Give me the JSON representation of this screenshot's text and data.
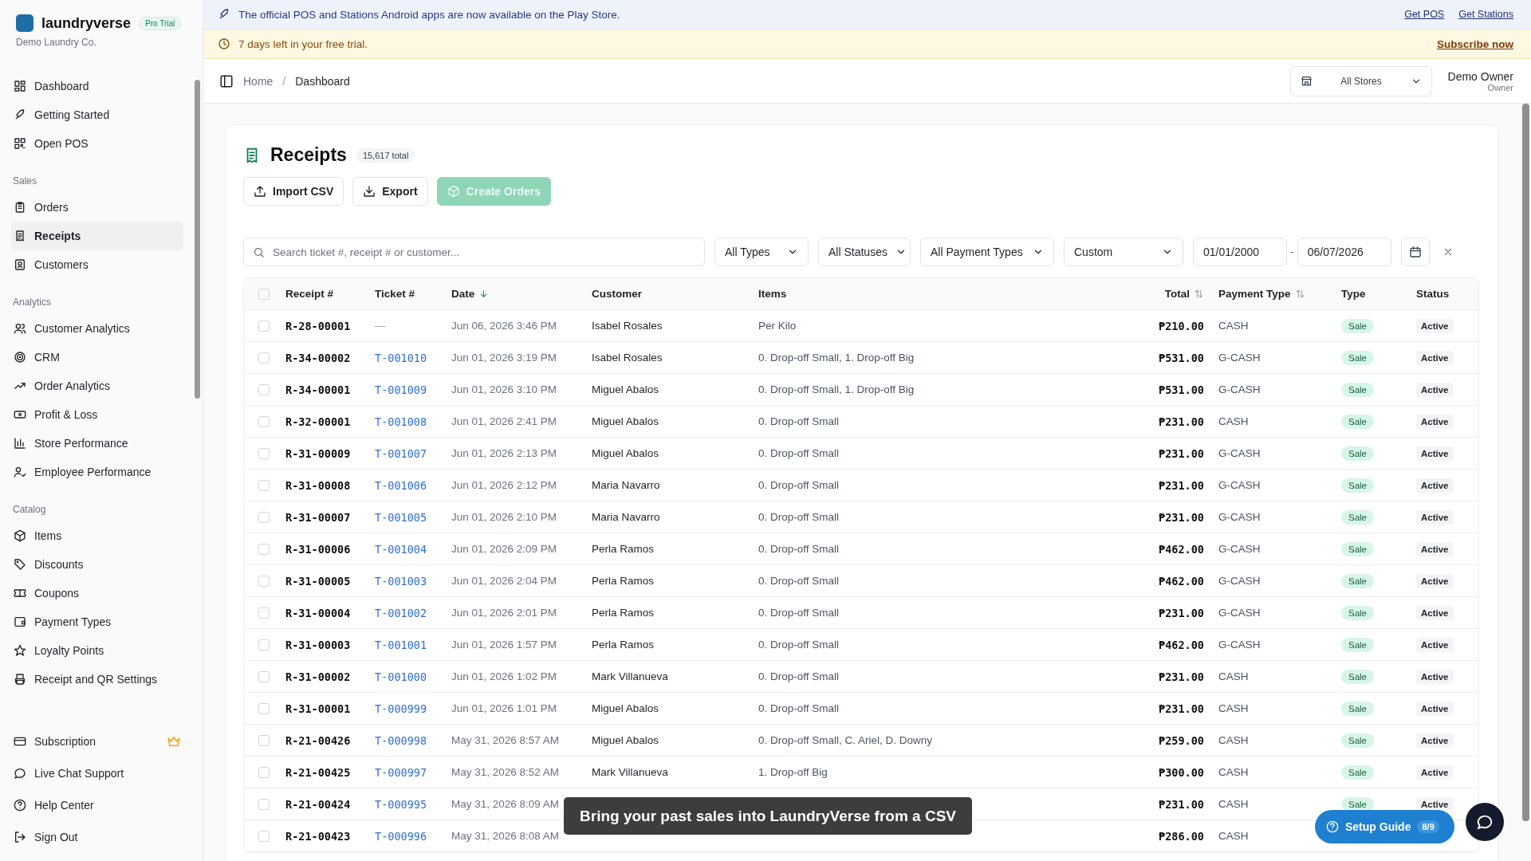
{
  "sidebar": {
    "brand": "laundryverse",
    "plan_badge": "Pro Trial",
    "company": "Demo Laundry Co.",
    "sections": [
      {
        "items": [
          {
            "label": "Dashboard",
            "selected": false
          },
          {
            "label": "Getting Started",
            "selected": false
          },
          {
            "label": "Open POS",
            "selected": false
          }
        ]
      },
      {
        "title": "Sales",
        "items": [
          {
            "label": "Orders",
            "selected": false
          },
          {
            "label": "Receipts",
            "selected": true
          },
          {
            "label": "Customers",
            "selected": false
          }
        ]
      },
      {
        "title": "Analytics",
        "items": [
          {
            "label": "Customer Analytics",
            "selected": false
          },
          {
            "label": "CRM",
            "selected": false
          },
          {
            "label": "Order Analytics",
            "selected": false
          },
          {
            "label": "Profit & Loss",
            "selected": false
          },
          {
            "label": "Store Performance",
            "selected": false
          },
          {
            "label": "Employee Performance",
            "selected": false
          }
        ]
      },
      {
        "title": "Catalog",
        "items": [
          {
            "label": "Items",
            "selected": false
          },
          {
            "label": "Discounts",
            "selected": false
          },
          {
            "label": "Coupons",
            "selected": false
          },
          {
            "label": "Payment Types",
            "selected": false
          },
          {
            "label": "Loyalty Points",
            "selected": false
          },
          {
            "label": "Receipt and QR Settings",
            "selected": false
          }
        ]
      }
    ],
    "bottom_items": [
      {
        "label": "Subscription",
        "premium": true
      },
      {
        "label": "Live Chat Support",
        "premium": false
      },
      {
        "label": "Help Center",
        "premium": false
      },
      {
        "label": "Sign Out",
        "premium": false
      }
    ]
  },
  "announcement": {
    "text": "The official POS and Stations Android apps are now available on the Play Store.",
    "links": [
      "Get POS",
      "Get Stations"
    ]
  },
  "trial_banner": {
    "text": "7 days left in your free trial.",
    "link": "Subscribe now"
  },
  "breadcrumb": [
    "Home",
    "Dashboard"
  ],
  "breadcrumb_separator": "/",
  "store_select": {
    "value": "All Stores"
  },
  "user": {
    "name": "Demo Owner",
    "role": "Owner"
  },
  "page": {
    "title": "Receipts",
    "count": "15,617 total",
    "actions": [
      {
        "label": "Import CSV",
        "kind": "upload",
        "disabled": false
      },
      {
        "label": "Export",
        "kind": "download",
        "disabled": false
      },
      {
        "label": "Create Orders",
        "kind": "create",
        "disabled": true
      }
    ]
  },
  "filters": {
    "search": {
      "placeholder": "Search ticket #, receipt # or customer..."
    },
    "selects": [
      "All Types",
      "All Statuses",
      "All Payment Types",
      "Custom"
    ],
    "date_from": "01/01/2000",
    "date_separator": "-",
    "date_to": "06/07/2026"
  },
  "table": {
    "all_checked": false,
    "columns": [
      {
        "label": "Receipt #",
        "sortable": false,
        "sorted": false
      },
      {
        "label": "Ticket #",
        "sortable": false,
        "sorted": false
      },
      {
        "label": "Date",
        "sortable": true,
        "sorted": true
      },
      {
        "label": "Customer",
        "sortable": false,
        "sorted": false
      },
      {
        "label": "Items",
        "sortable": false,
        "sorted": false
      },
      {
        "label": "Total",
        "sortable": true,
        "sorted": false
      },
      {
        "label": "Payment Type",
        "sortable": true,
        "sorted": false
      },
      {
        "label": "Type",
        "sortable": false,
        "sorted": false
      },
      {
        "label": "Status",
        "sortable": false,
        "sorted": false
      }
    ],
    "rows": [
      {
        "checked": false,
        "receipt": "R-28-00001",
        "ticket": "—",
        "linked": false,
        "date": "Jun 06, 2026 3:46 PM",
        "customer": "Isabel Rosales",
        "items": "Per Kilo",
        "total": "₱210.00",
        "payment": "CASH",
        "type": "Sale",
        "status": "Active"
      },
      {
        "checked": false,
        "receipt": "R-34-00002",
        "ticket": "T-001010",
        "linked": true,
        "date": "Jun 01, 2026 3:19 PM",
        "customer": "Isabel Rosales",
        "items": "0. Drop-off Small, 1. Drop-off Big",
        "total": "₱531.00",
        "payment": "G-CASH",
        "type": "Sale",
        "status": "Active"
      },
      {
        "checked": false,
        "receipt": "R-34-00001",
        "ticket": "T-001009",
        "linked": true,
        "date": "Jun 01, 2026 3:10 PM",
        "customer": "Miguel Abalos",
        "items": "0. Drop-off Small, 1. Drop-off Big",
        "total": "₱531.00",
        "payment": "G-CASH",
        "type": "Sale",
        "status": "Active"
      },
      {
        "checked": false,
        "receipt": "R-32-00001",
        "ticket": "T-001008",
        "linked": true,
        "date": "Jun 01, 2026 2:41 PM",
        "customer": "Miguel Abalos",
        "items": "0. Drop-off Small",
        "total": "₱231.00",
        "payment": "CASH",
        "type": "Sale",
        "status": "Active"
      },
      {
        "checked": false,
        "receipt": "R-31-00009",
        "ticket": "T-001007",
        "linked": true,
        "date": "Jun 01, 2026 2:13 PM",
        "customer": "Miguel Abalos",
        "items": "0. Drop-off Small",
        "total": "₱231.00",
        "payment": "G-CASH",
        "type": "Sale",
        "status": "Active"
      },
      {
        "checked": false,
        "receipt": "R-31-00008",
        "ticket": "T-001006",
        "linked": true,
        "date": "Jun 01, 2026 2:12 PM",
        "customer": "Maria Navarro",
        "items": "0. Drop-off Small",
        "total": "₱231.00",
        "payment": "G-CASH",
        "type": "Sale",
        "status": "Active"
      },
      {
        "checked": false,
        "receipt": "R-31-00007",
        "ticket": "T-001005",
        "linked": true,
        "date": "Jun 01, 2026 2:10 PM",
        "customer": "Maria Navarro",
        "items": "0. Drop-off Small",
        "total": "₱231.00",
        "payment": "G-CASH",
        "type": "Sale",
        "status": "Active"
      },
      {
        "checked": false,
        "receipt": "R-31-00006",
        "ticket": "T-001004",
        "linked": true,
        "date": "Jun 01, 2026 2:09 PM",
        "customer": "Perla Ramos",
        "items": "0. Drop-off Small",
        "total": "₱462.00",
        "payment": "G-CASH",
        "type": "Sale",
        "status": "Active"
      },
      {
        "checked": false,
        "receipt": "R-31-00005",
        "ticket": "T-001003",
        "linked": true,
        "date": "Jun 01, 2026 2:04 PM",
        "customer": "Perla Ramos",
        "items": "0. Drop-off Small",
        "total": "₱462.00",
        "payment": "G-CASH",
        "type": "Sale",
        "status": "Active"
      },
      {
        "checked": false,
        "receipt": "R-31-00004",
        "ticket": "T-001002",
        "linked": true,
        "date": "Jun 01, 2026 2:01 PM",
        "customer": "Perla Ramos",
        "items": "0. Drop-off Small",
        "total": "₱231.00",
        "payment": "G-CASH",
        "type": "Sale",
        "status": "Active"
      },
      {
        "checked": false,
        "receipt": "R-31-00003",
        "ticket": "T-001001",
        "linked": true,
        "date": "Jun 01, 2026 1:57 PM",
        "customer": "Perla Ramos",
        "items": "0. Drop-off Small",
        "total": "₱462.00",
        "payment": "G-CASH",
        "type": "Sale",
        "status": "Active"
      },
      {
        "checked": false,
        "receipt": "R-31-00002",
        "ticket": "T-001000",
        "linked": true,
        "date": "Jun 01, 2026 1:02 PM",
        "customer": "Mark Villanueva",
        "items": "0. Drop-off Small",
        "total": "₱231.00",
        "payment": "CASH",
        "type": "Sale",
        "status": "Active"
      },
      {
        "checked": false,
        "receipt": "R-31-00001",
        "ticket": "T-000999",
        "linked": true,
        "date": "Jun 01, 2026 1:01 PM",
        "customer": "Miguel Abalos",
        "items": "0. Drop-off Small",
        "total": "₱231.00",
        "payment": "CASH",
        "type": "Sale",
        "status": "Active"
      },
      {
        "checked": false,
        "receipt": "R-21-00426",
        "ticket": "T-000998",
        "linked": true,
        "date": "May 31, 2026 8:57 AM",
        "customer": "Miguel Abalos",
        "items": "0. Drop-off Small, C. Ariel, D. Downy",
        "total": "₱259.00",
        "payment": "CASH",
        "type": "Sale",
        "status": "Active"
      },
      {
        "checked": false,
        "receipt": "R-21-00425",
        "ticket": "T-000997",
        "linked": true,
        "date": "May 31, 2026 8:52 AM",
        "customer": "Mark Villanueva",
        "items": "1. Drop-off Big",
        "total": "₱300.00",
        "payment": "CASH",
        "type": "Sale",
        "status": "Active"
      },
      {
        "checked": false,
        "receipt": "R-21-00424",
        "ticket": "T-000995",
        "linked": true,
        "date": "May 31, 2026 8:09 AM",
        "total": "₱231.00",
        "payment": "CASH",
        "type": "Sale",
        "status": "Active"
      },
      {
        "checked": false,
        "receipt": "R-21-00423",
        "ticket": "T-000996",
        "linked": true,
        "date": "May 31, 2026 8:08 AM",
        "total": "₱286.00",
        "payment": "CASH"
      }
    ]
  },
  "toast": {
    "text": "Bring your past sales into LaundryVerse from a CSV"
  },
  "setup_guide": {
    "label": "Setup Guide",
    "progress": "8/9"
  }
}
